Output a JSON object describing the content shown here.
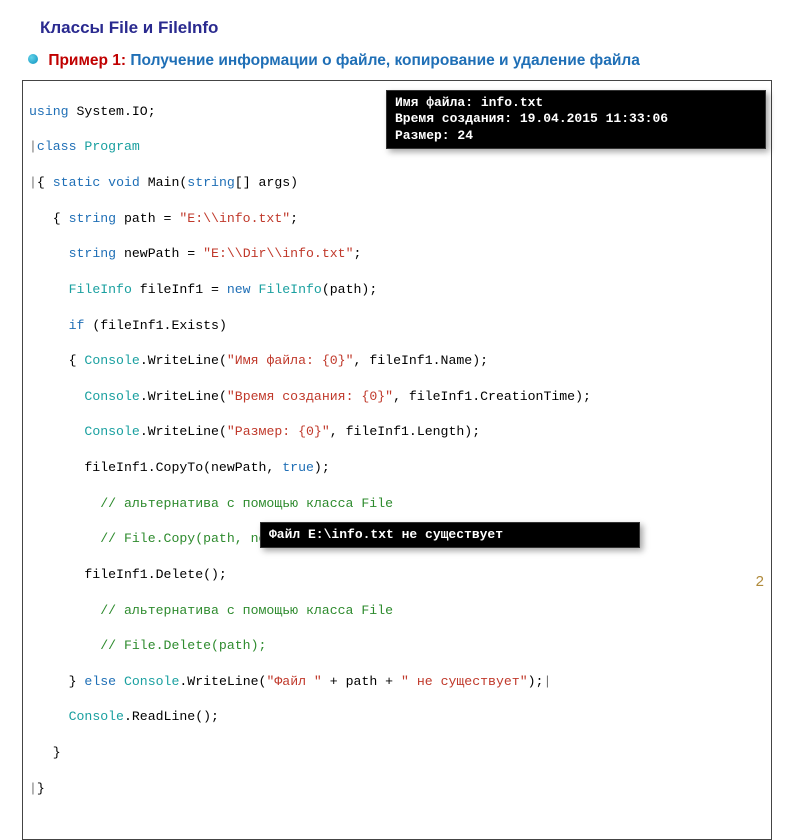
{
  "title": "Классы File и FileInfo",
  "example": {
    "label": "Пример 1:",
    "desc": "Получение информации о файле, копирование и удаление файла"
  },
  "code": {
    "l01a": "using",
    "l01b": " System.IO;",
    "l02a": "class",
    "l02b": " ",
    "l02c": "Program",
    "l03a": "{ ",
    "l03b": "static",
    "l03c": " ",
    "l03d": "void",
    "l03e": " Main(",
    "l03f": "string",
    "l03g": "[] args)",
    "l04a": "   { ",
    "l04b": "string",
    "l04c": " path = ",
    "l04d": "\"E:\\\\info.txt\"",
    "l04e": ";",
    "l05a": "     ",
    "l05b": "string",
    "l05c": " newPath = ",
    "l05d": "\"E:\\\\Dir\\\\info.txt\"",
    "l05e": ";",
    "l06a": "     ",
    "l06b": "FileInfo",
    "l06c": " fileInf1 = ",
    "l06d": "new",
    "l06e": " ",
    "l06f": "FileInfo",
    "l06g": "(path);",
    "l07a": "     ",
    "l07b": "if",
    "l07c": " (fileInf1.Exists)",
    "l08a": "     { ",
    "l08b": "Console",
    "l08c": ".WriteLine(",
    "l08d": "\"Имя файла: {0}\"",
    "l08e": ", fileInf1.Name);",
    "l09a": "       ",
    "l09b": "Console",
    "l09c": ".WriteLine(",
    "l09d": "\"Время создания: {0}\"",
    "l09e": ", fileInf1.CreationTime);",
    "l10a": "       ",
    "l10b": "Console",
    "l10c": ".WriteLine(",
    "l10d": "\"Размер: {0}\"",
    "l10e": ", fileInf1.Length);",
    "l11": "       fileInf1.CopyTo(newPath, ",
    "l11b": "true",
    "l11c": ");",
    "l12": "         // альтернатива с помощью класса File",
    "l13": "         // File.Copy(path, newPath, true);",
    "l14": "       fileInf1.Delete();",
    "l15": "         // альтернатива с помощью класса File",
    "l16": "         // File.Delete(path);",
    "l17a": "     } ",
    "l17b": "else",
    "l17c": " ",
    "l17d": "Console",
    "l17e": ".WriteLine(",
    "l17f": "\"Файл \"",
    "l17g": " + path + ",
    "l17h": "\" не существует\"",
    "l17i": ");",
    "l18a": "     ",
    "l18b": "Console",
    "l18c": ".ReadLine();",
    "l19": "   }",
    "l20": "}"
  },
  "console1": "Имя файла: info.txt\nВремя создания: 19.04.2015 11:33:06\nРазмер: 24",
  "console2": "Файл E:\\info.txt не существует",
  "page_number": "2"
}
